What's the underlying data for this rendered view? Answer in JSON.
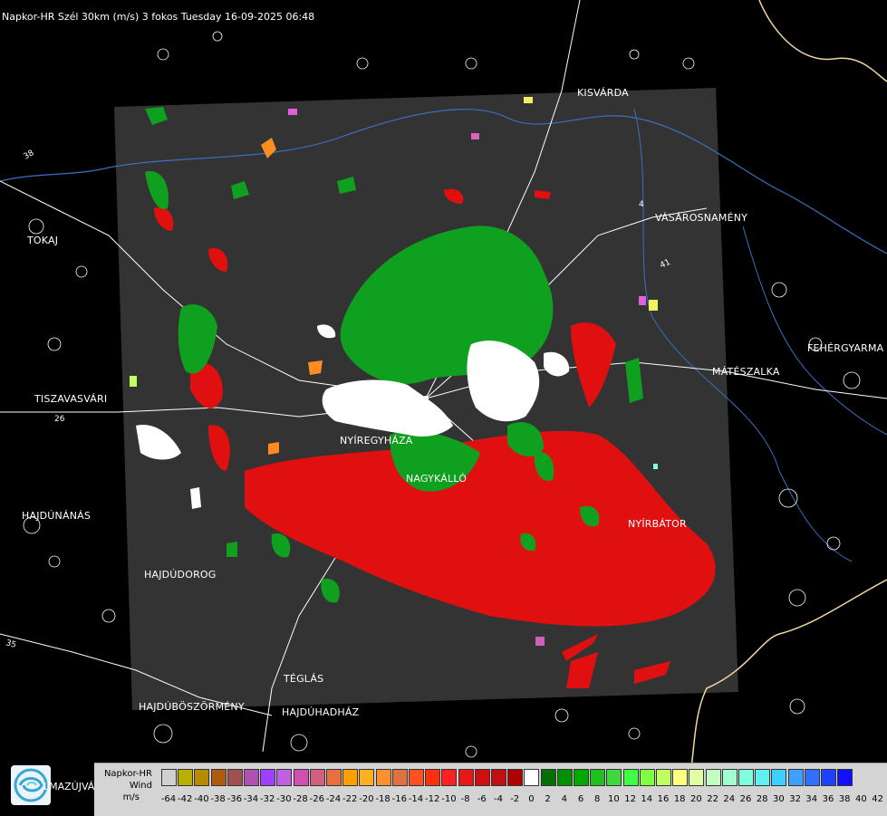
{
  "title": "Napkor-HR Szél 30km (m/s) 3 fokos Tuesday 16-09-2025 06:48",
  "cities": {
    "kisvarda": "KISVÁRDA",
    "tokaj": "TOKAJ",
    "vasarosnameny": "VÁSÁROSNAMÉNY",
    "fehergyarmat": "FEHÉRGYARMA",
    "tiszavasvari": "TISZAVASVÁRI",
    "mateszalka": "MÁTÉSZALKA",
    "nagykallo": "NAGYKÁLLÓ",
    "nyiregyhaza": "NYÍREGYHÁZA",
    "hajdunanas": "HAJDÚNÁNÁS",
    "nyirbator": "NYÍRBÁTOR",
    "hajdudorog": "HAJDÚDOROG",
    "teglas": "TÉGLÁS",
    "hajduboszormeny": "HAJDÚBÖSZÖRMÉNY",
    "hajduhadhaz": "HAJDÚHADHÁZ",
    "hajdusamson": "LMAZÚJVÁR"
  },
  "road_numbers": {
    "r26": "26",
    "r35": "35",
    "r38": "38",
    "r4": "4",
    "r41": "41"
  },
  "legend": {
    "line1": "Napkor-HR",
    "line2": "Wind",
    "line3": "m/s",
    "colors": [
      "#d0d0d0",
      "#b8b000",
      "#b88a00",
      "#b05a10",
      "#a05050",
      "#b050b0",
      "#a040ff",
      "#c060e0",
      "#d050b0",
      "#d06080",
      "#e87040",
      "#ffa000",
      "#ffb020",
      "#ff9030",
      "#e07040",
      "#ff5020",
      "#ff3010",
      "#ff2020",
      "#e81818",
      "#d01010",
      "#c01010",
      "#b00000",
      "#ffffff",
      "#007000",
      "#009000",
      "#00a800",
      "#20c020",
      "#40d840",
      "#40ff40",
      "#80ff40",
      "#c0ff60",
      "#ffff80",
      "#e0ffa0",
      "#c0ffc0",
      "#a0ffd0",
      "#80ffe0",
      "#60f0f0",
      "#40d0ff",
      "#40a0ff",
      "#3070ff",
      "#2040ff",
      "#1010ff"
    ],
    "ticks": [
      "-64",
      "-42",
      "-40",
      "-38",
      "-36",
      "-34",
      "-32",
      "-30",
      "-28",
      "-26",
      "-24",
      "-22",
      "-20",
      "-18",
      "-16",
      "-14",
      "-12",
      "-10",
      "-8",
      "-6",
      "-4",
      "-2",
      "0",
      "2",
      "4",
      "6",
      "8",
      "10",
      "12",
      "14",
      "16",
      "18",
      "20",
      "22",
      "24",
      "26",
      "28",
      "30",
      "32",
      "34",
      "36",
      "38",
      "40",
      "42"
    ]
  }
}
